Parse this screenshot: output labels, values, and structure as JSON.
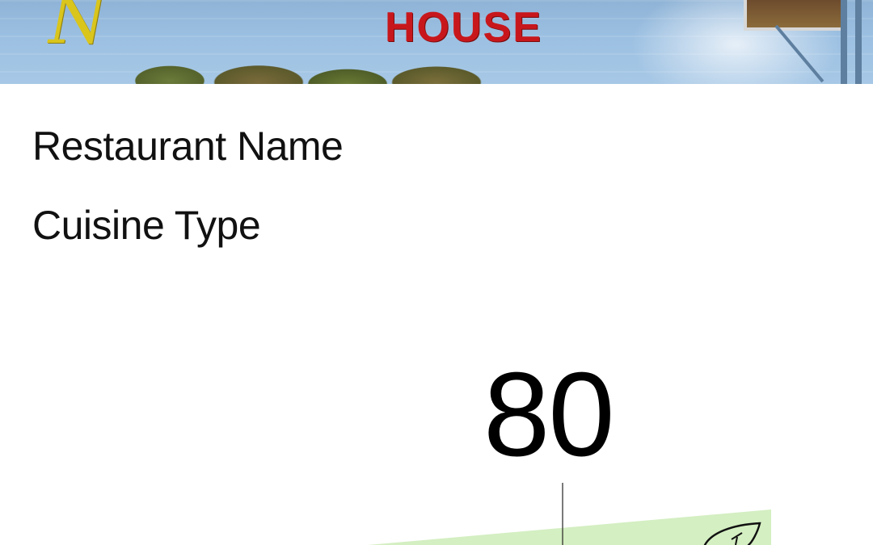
{
  "hero": {
    "sign_text": "HOUSE",
    "logo_script": "N"
  },
  "restaurant": {
    "name_label": "Restaurant Name",
    "cuisine_label": "Cuisine Type"
  },
  "score": {
    "value": "80"
  },
  "colors": {
    "gauge_fill": "#d4efc2",
    "sign_red": "#c8171c",
    "logo_yellow": "#d9c51c"
  },
  "icons": {
    "gauge_badge": "leaf-icon"
  }
}
